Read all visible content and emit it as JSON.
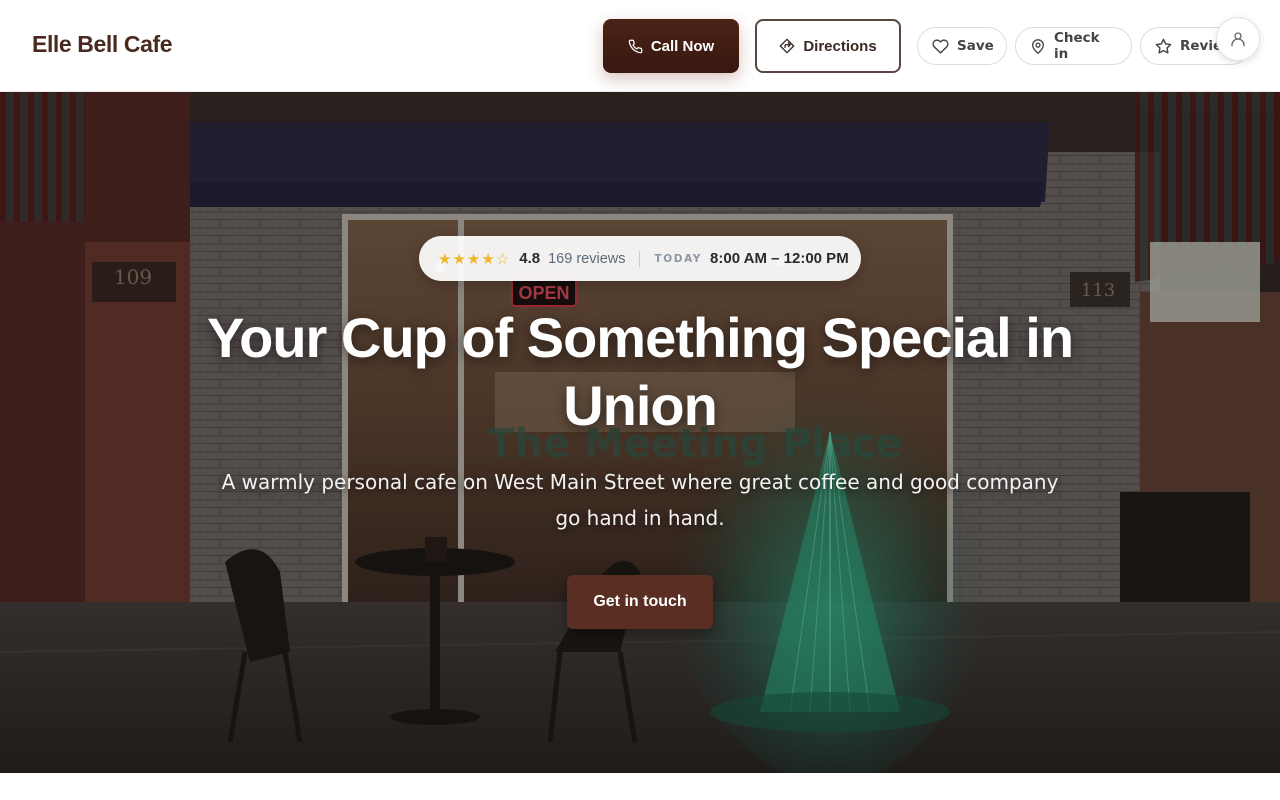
{
  "header": {
    "brand": "Elle Bell Cafe",
    "call_label": "Call Now",
    "directions_label": "Directions",
    "save_label": "Save",
    "checkin_label": "Check in",
    "review_label": "Review"
  },
  "hero": {
    "rating_stars": "★★★★☆",
    "rating": "4.8",
    "reviews": "169 reviews",
    "today_label": "TODAY",
    "hours": "8:00 AM – 12:00 PM",
    "title": "Your Cup of Something Special in Union",
    "subtitle": "A warmly personal cafe on West Main Street where great coffee and good company go hand in hand.",
    "cta_label": "Get in touch",
    "storefront_sign": "OPEN",
    "window_text": "The Meeting Place",
    "address_left": "109",
    "address_right": "113"
  },
  "colors": {
    "brand": "#4a2a1e",
    "call_bg": "#4b2217",
    "cta_bg": "#5a2e22",
    "star": "#f0b429"
  }
}
